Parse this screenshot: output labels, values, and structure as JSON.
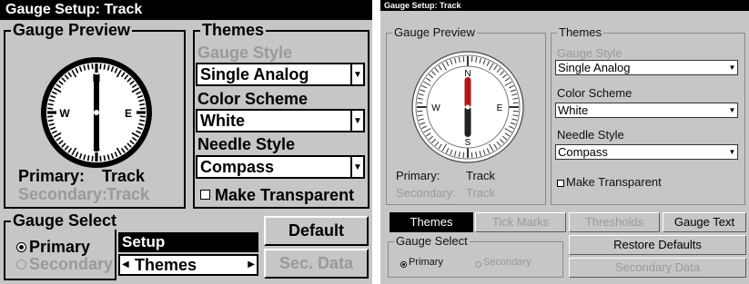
{
  "left_screen": {
    "title": "Gauge Setup: Track",
    "gauge_preview": {
      "legend": "Gauge Preview",
      "dial_labels": {
        "n": "N",
        "s": "S",
        "e": "E",
        "w": "W"
      },
      "primary_label": "Primary:",
      "primary_value": "Track",
      "secondary_label": "Secondary:",
      "secondary_value": "Track"
    },
    "themes": {
      "legend": "Themes",
      "gauge_style_label": "Gauge Style",
      "gauge_style_value": "Single Analog",
      "color_scheme_label": "Color Scheme",
      "color_scheme_value": "White",
      "needle_style_label": "Needle Style",
      "needle_style_value": "Compass",
      "make_transparent_label": "Make Transparent",
      "make_transparent_checked": false
    },
    "gauge_select": {
      "legend": "Gauge Select",
      "primary_label": "Primary",
      "secondary_label": "Secondary",
      "selected": "Primary"
    },
    "setup": {
      "title": "Setup",
      "current": "Themes",
      "left_arrow": "◀",
      "right_arrow": "▶"
    },
    "buttons": {
      "default": "Default",
      "sec_data": "Sec. Data"
    }
  },
  "right_screen": {
    "title": "Gauge Setup: Track",
    "gauge_preview": {
      "legend": "Gauge Preview",
      "dial_labels": {
        "n": "N",
        "s": "S",
        "e": "E",
        "w": "W"
      },
      "primary_label": "Primary:",
      "primary_value": "Track",
      "secondary_label": "Secondary:",
      "secondary_value": "Track"
    },
    "themes": {
      "legend": "Themes",
      "gauge_style_label": "Gauge Style",
      "gauge_style_value": "Single Analog",
      "color_scheme_label": "Color Scheme",
      "color_scheme_value": "White",
      "needle_style_label": "Needle Style",
      "needle_style_value": "Compass",
      "make_transparent_label": "Make Transparent",
      "make_transparent_checked": false
    },
    "tabs": [
      "Themes",
      "Tick Marks",
      "Thresholds",
      "Gauge Text"
    ],
    "active_tab": "Themes",
    "gauge_select": {
      "legend": "Gauge Select",
      "primary_label": "Primary",
      "secondary_label": "Secondary",
      "selected": "Primary"
    },
    "buttons": {
      "restore_defaults": "Restore Defaults",
      "secondary_data": "Secondary Data"
    }
  },
  "icons": {
    "dropdown_arrow": "▼",
    "needle": "compass-needle-icon"
  },
  "colors": {
    "panel_bg": "#c6c6c6",
    "titlebar_bg": "#000000",
    "disabled_text": "#9a9a9a"
  }
}
